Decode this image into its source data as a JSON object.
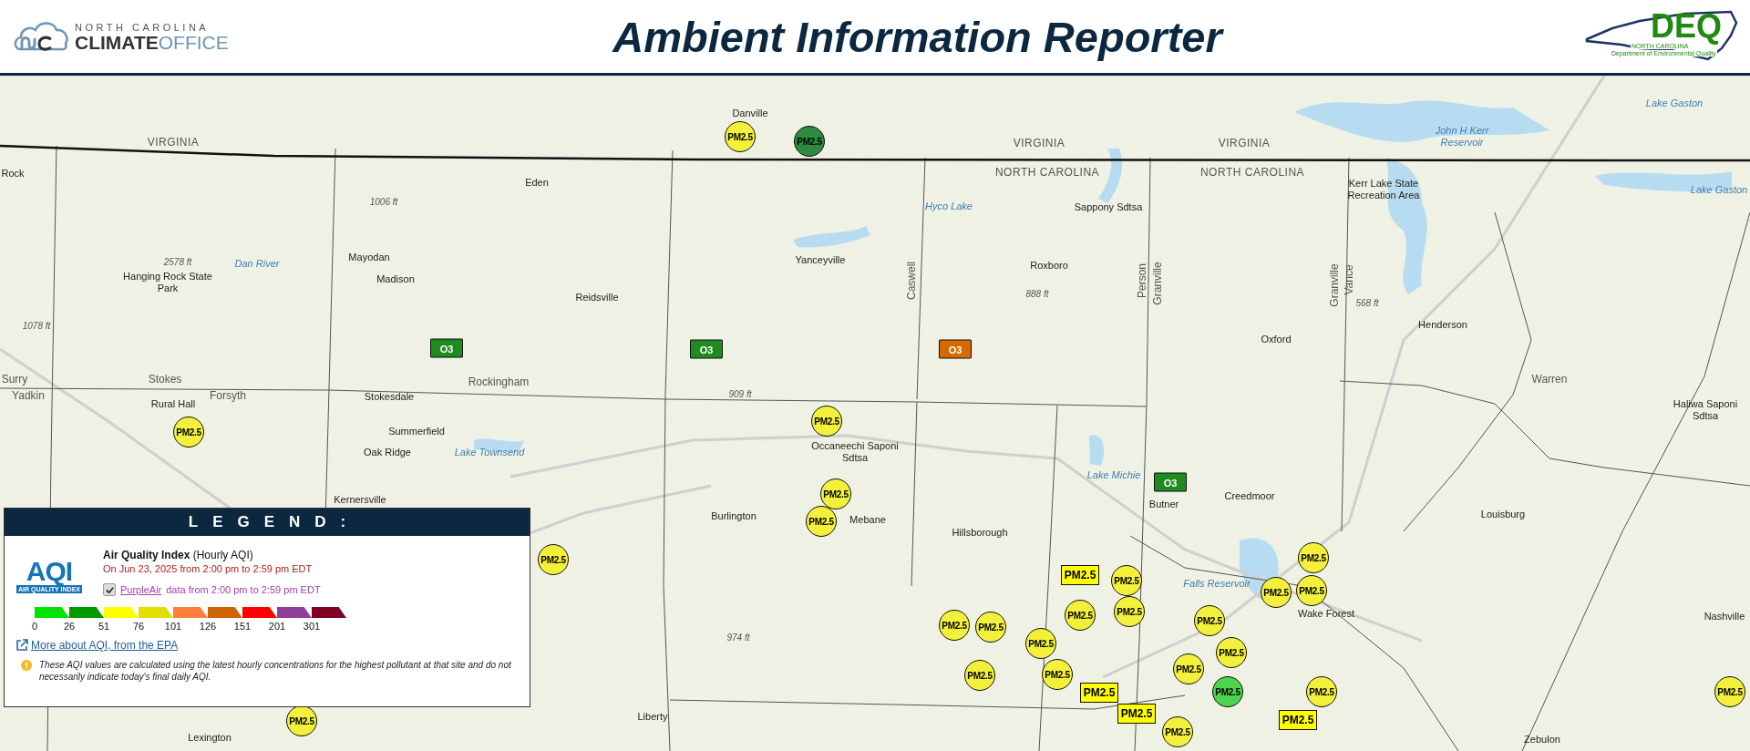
{
  "header": {
    "logo_left": {
      "line1": "NORTH CAROLINA",
      "line2_bold": "CLIMATE",
      "line2_light": "OFFICE"
    },
    "title": "Ambient Information Reporter",
    "logo_right": {
      "mark": "DEQ",
      "line1": "NORTH CAROLINA",
      "line2": "Department of Environmental Quality"
    }
  },
  "map": {
    "labels": [
      {
        "text": "Lake Gaston",
        "kind": "water"
      },
      {
        "text": "Danville",
        "kind": "place"
      },
      {
        "text": "VIRGINIA",
        "kind": "region"
      },
      {
        "text": "VIRGINIA",
        "kind": "region"
      },
      {
        "text": "VIRGINIA",
        "kind": "region"
      },
      {
        "text": "John H Kerr Reservoir",
        "kind": "water"
      },
      {
        "text": "Rock",
        "kind": "place"
      },
      {
        "text": "NORTH CAROLINA",
        "kind": "region"
      },
      {
        "text": "NORTH CAROLINA",
        "kind": "region"
      },
      {
        "text": "Eden",
        "kind": "place"
      },
      {
        "text": "Kerr Lake State Recreation Area",
        "kind": "place"
      },
      {
        "text": "Lake Gaston",
        "kind": "water"
      },
      {
        "text": "1006 ft",
        "kind": "elevation"
      },
      {
        "text": "Hyco Lake",
        "kind": "water"
      },
      {
        "text": "Sappony Sdtsa",
        "kind": "place"
      },
      {
        "text": "2578 ft",
        "kind": "elevation"
      },
      {
        "text": "Dan River",
        "kind": "water"
      },
      {
        "text": "Mayodan",
        "kind": "place"
      },
      {
        "text": "Yanceyville",
        "kind": "place"
      },
      {
        "text": "Roxboro",
        "kind": "place"
      },
      {
        "text": "Hanging Rock State Park",
        "kind": "place"
      },
      {
        "text": "Madison",
        "kind": "place"
      },
      {
        "text": "Caswell",
        "kind": "county-vertical"
      },
      {
        "text": "Person",
        "kind": "county-vertical"
      },
      {
        "text": "Granville",
        "kind": "county-vertical"
      },
      {
        "text": "Granville",
        "kind": "county-vertical"
      },
      {
        "text": "Vance",
        "kind": "county-vertical"
      },
      {
        "text": "Reidsville",
        "kind": "place"
      },
      {
        "text": "888 ft",
        "kind": "elevation"
      },
      {
        "text": "568 ft",
        "kind": "elevation"
      },
      {
        "text": "1078 ft",
        "kind": "elevation"
      },
      {
        "text": "Henderson",
        "kind": "place"
      },
      {
        "text": "Oxford",
        "kind": "place"
      },
      {
        "text": "Surry",
        "kind": "county"
      },
      {
        "text": "Stokes",
        "kind": "county"
      },
      {
        "text": "Warren",
        "kind": "county"
      },
      {
        "text": "Yadkin",
        "kind": "county"
      },
      {
        "text": "Forsyth",
        "kind": "county"
      },
      {
        "text": "Stokesdale",
        "kind": "place"
      },
      {
        "text": "Rockingham",
        "kind": "county"
      },
      {
        "text": "909 ft",
        "kind": "elevation"
      },
      {
        "text": "Rural Hall",
        "kind": "place"
      },
      {
        "text": "Haliwa Saponi Sdtsa",
        "kind": "place"
      },
      {
        "text": "Summerfield",
        "kind": "place"
      },
      {
        "text": "Oak Ridge",
        "kind": "place"
      },
      {
        "text": "Lake Townsend",
        "kind": "water"
      },
      {
        "text": "Occaneechi Saponi Sdtsa",
        "kind": "place"
      },
      {
        "text": "Lake Michie",
        "kind": "water"
      },
      {
        "text": "Kernersville",
        "kind": "place"
      },
      {
        "text": "Butner",
        "kind": "place"
      },
      {
        "text": "Creedmoor",
        "kind": "place"
      },
      {
        "text": "Burlington",
        "kind": "place"
      },
      {
        "text": "Mebane",
        "kind": "place"
      },
      {
        "text": "Louisburg",
        "kind": "place"
      },
      {
        "text": "Hillsborough",
        "kind": "place"
      },
      {
        "text": "Falls Reservoir",
        "kind": "water"
      },
      {
        "text": "Wake Forest",
        "kind": "place"
      },
      {
        "text": "Nashville",
        "kind": "place"
      },
      {
        "text": "974 ft",
        "kind": "elevation"
      },
      {
        "text": "Liberty",
        "kind": "place"
      },
      {
        "text": "Lexington",
        "kind": "place"
      },
      {
        "text": "Zebulon",
        "kind": "place"
      }
    ],
    "markers": [
      {
        "kind": "circle",
        "label": "PM2.5",
        "color": "#f2f03a"
      },
      {
        "kind": "circle",
        "label": "PM2.5",
        "color": "#2e8b3e"
      },
      {
        "kind": "square",
        "label": "O3",
        "color": "#1f8a1f"
      },
      {
        "kind": "square",
        "label": "O3",
        "color": "#1f8a1f"
      },
      {
        "kind": "square",
        "label": "O3",
        "color": "#d46a00"
      },
      {
        "kind": "circle",
        "label": "PM2.5",
        "color": "#f2f03a"
      },
      {
        "kind": "circle",
        "label": "PM2.5",
        "color": "#f2f03a"
      },
      {
        "kind": "square",
        "label": "O3",
        "color": "#1f8a1f"
      },
      {
        "kind": "circle",
        "label": "PM2.5",
        "color": "#f2f03a"
      },
      {
        "kind": "circle",
        "label": "PM2.5",
        "color": "#f2f03a"
      },
      {
        "kind": "circle",
        "label": "PM2.5",
        "color": "#f2f03a"
      },
      {
        "kind": "circle",
        "label": "PM2.5",
        "color": "#f2f03a"
      },
      {
        "kind": "rect",
        "label": "PM2.5",
        "color": "#ffff00"
      },
      {
        "kind": "circle",
        "label": "PM2.5",
        "color": "#f2f03a"
      },
      {
        "kind": "circle",
        "label": "PM2.5",
        "color": "#f2f03a"
      },
      {
        "kind": "circle",
        "label": "PM2.5",
        "color": "#f2f03a"
      },
      {
        "kind": "circle",
        "label": "PM2.5",
        "color": "#f2f03a"
      },
      {
        "kind": "circle",
        "label": "PM2.5",
        "color": "#f2f03a"
      },
      {
        "kind": "circle",
        "label": "PM2.5",
        "color": "#f2f03a"
      },
      {
        "kind": "circle",
        "label": "PM2.5",
        "color": "#f2f03a"
      },
      {
        "kind": "circle",
        "label": "PM2.5",
        "color": "#f2f03a"
      },
      {
        "kind": "circle",
        "label": "PM2.5",
        "color": "#f2f03a"
      },
      {
        "kind": "circle",
        "label": "PM2.5",
        "color": "#f2f03a"
      },
      {
        "kind": "circle",
        "label": "PM2.5",
        "color": "#f2f03a"
      },
      {
        "kind": "circle",
        "label": "PM2.5",
        "color": "#f2f03a"
      },
      {
        "kind": "circle",
        "label": "PM2.5",
        "color": "#f2f03a"
      },
      {
        "kind": "rect",
        "label": "PM2.5",
        "color": "#ffff00"
      },
      {
        "kind": "circle",
        "label": "PM2.5",
        "color": "#4cd44c"
      },
      {
        "kind": "circle",
        "label": "PM2.5",
        "color": "#f2f03a"
      },
      {
        "kind": "circle",
        "label": "PM2.5",
        "color": "#f2f03a"
      },
      {
        "kind": "circle",
        "label": "PM2.5",
        "color": "#f2f03a"
      },
      {
        "kind": "rect",
        "label": "PM2.5",
        "color": "#ffff00"
      },
      {
        "kind": "circle",
        "label": "PM2.5",
        "color": "#f2f03a"
      },
      {
        "kind": "rect",
        "label": "PM2.5",
        "color": "#ffff00"
      }
    ]
  },
  "legend": {
    "title": "LEGEND:",
    "aqi_logo": {
      "text": "AQI",
      "caption": "AIR QUALITY INDEX"
    },
    "heading": "**Air Quality Index** (Hourly AQI)",
    "date_range": "On Jun 23, 2025 from 2:00 pm to 2:59 pm EDT",
    "purpleair": {
      "checked": true,
      "link": "PurpleAir",
      "text": "data from 2:00 pm to 2:59 pm EDT"
    },
    "scale": [
      {
        "color": "#00e400",
        "tick": "0"
      },
      {
        "color": "#009900",
        "tick": "26"
      },
      {
        "color": "#ffff00",
        "tick": "51"
      },
      {
        "color": "#e0e000",
        "tick": "76"
      },
      {
        "color": "#ff7e3e",
        "tick": "101"
      },
      {
        "color": "#cc6600",
        "tick": "126"
      },
      {
        "color": "#ff0000",
        "tick": "151"
      },
      {
        "color": "#8f3f97",
        "tick": "201"
      },
      {
        "color": "#7e0023",
        "tick": "301"
      }
    ],
    "epa_link": "More about AQI, from the EPA",
    "note": "These AQI values are calculated using the latest hourly concentrations for the highest pollutant at that site and do not necessarily indicate today's final daily AQI."
  }
}
